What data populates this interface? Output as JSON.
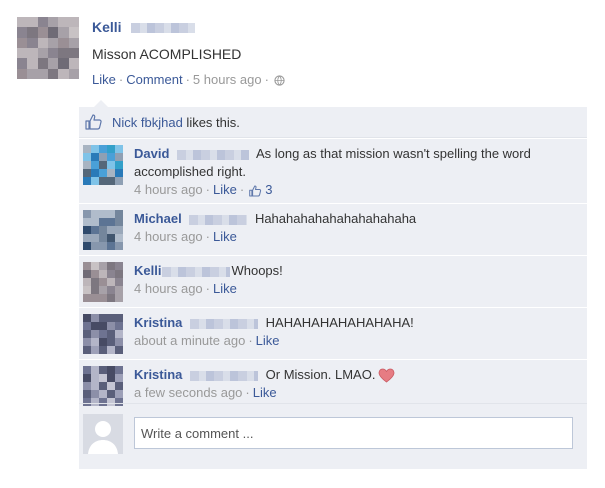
{
  "post": {
    "author": "Kelli",
    "message": "Misson ACOMPLISHED",
    "like_label": "Like",
    "comment_label": "Comment",
    "time": "5 hours ago",
    "privacy_icon": "globe-icon"
  },
  "likes": {
    "name": "Nick fbkjhad",
    "suffix": " likes this."
  },
  "comments": [
    {
      "name": "David",
      "text": "As long as that mission wasn't spelling the word accomplished right.",
      "time": "4 hours ago",
      "like_label": "Like",
      "like_count": "3"
    },
    {
      "name": "Michael",
      "text": "Hahahahahahahahahahaha",
      "time": "4 hours ago",
      "like_label": "Like"
    },
    {
      "name": "Kelli",
      "text": "Whoops!",
      "time": "4 hours ago",
      "like_label": "Like"
    },
    {
      "name": "Kristina",
      "text": "HAHAHAHAHAHAHAHA!",
      "time": "about a minute ago",
      "like_label": "Like"
    },
    {
      "name": "Kristina",
      "text": "Or Mission. LMAO.",
      "time": "a few seconds ago",
      "like_label": "Like"
    }
  ],
  "write_comment": {
    "placeholder": "Write a comment ..."
  },
  "colors": {
    "link": "#3b5998",
    "panel": "#edeff4",
    "heart": "#e67c83"
  }
}
